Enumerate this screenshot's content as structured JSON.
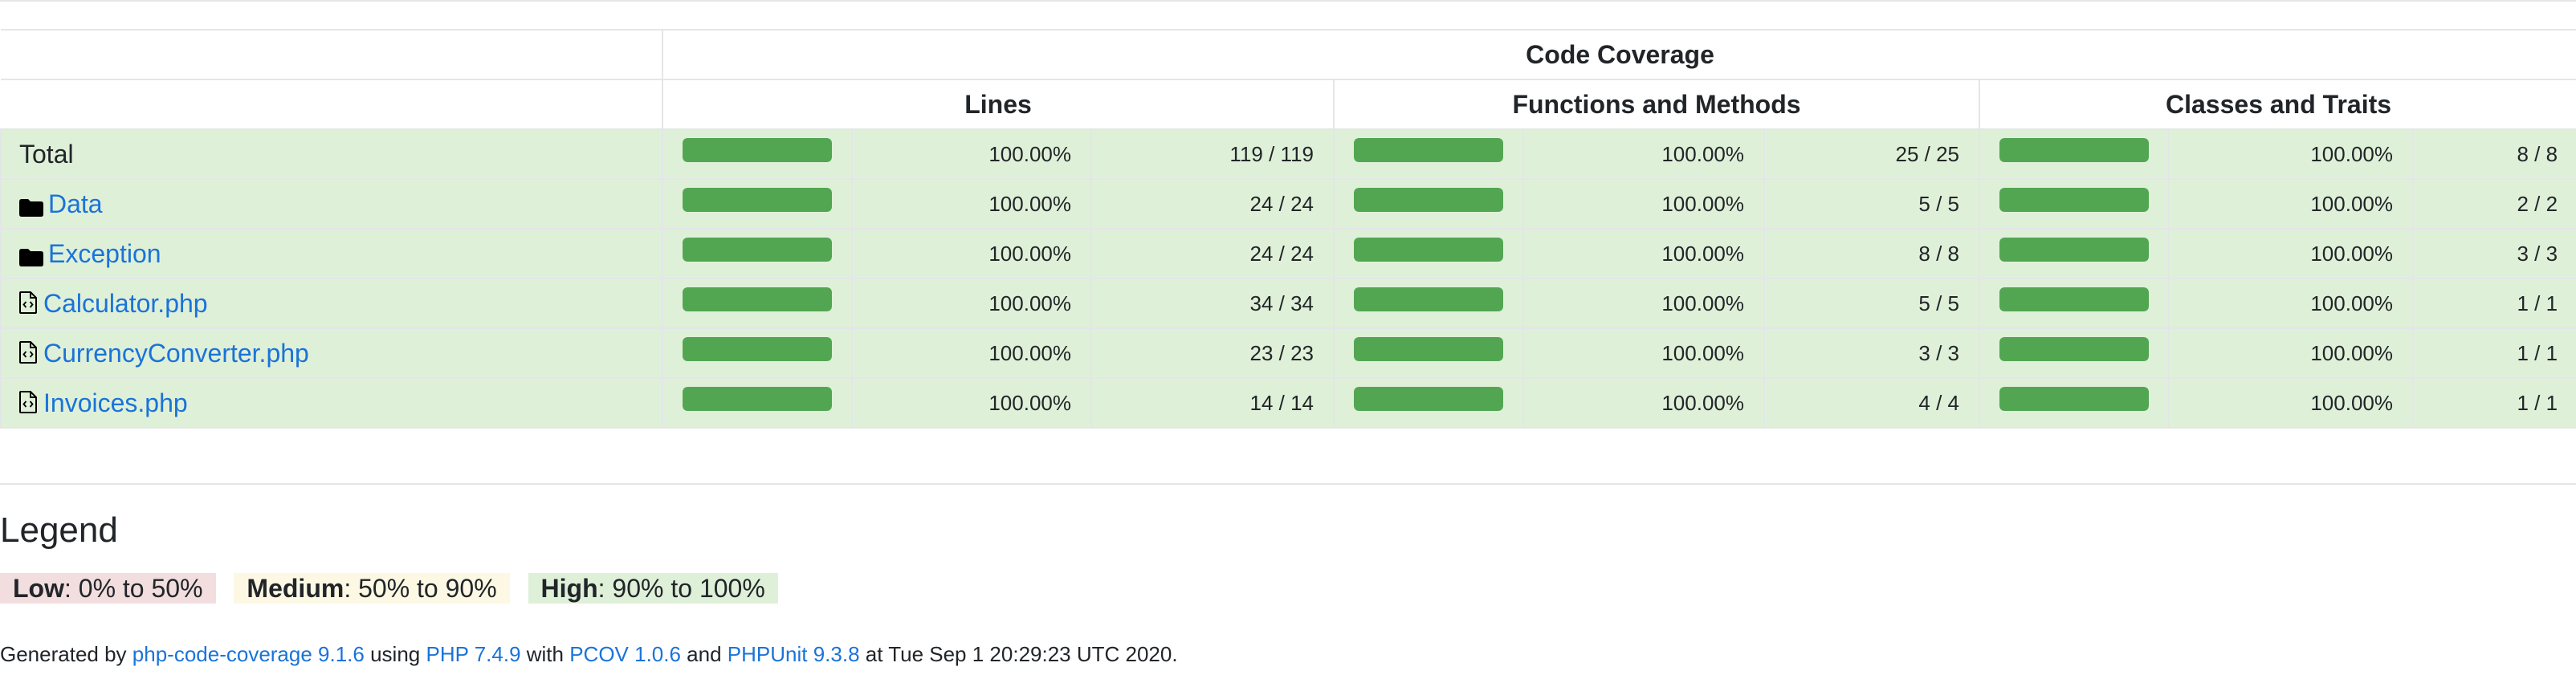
{
  "table": {
    "header": "Code Coverage",
    "groups": [
      "Lines",
      "Functions and Methods",
      "Classes and Traits"
    ],
    "rows": [
      {
        "name": "Total",
        "type": "total",
        "lines": {
          "pct": "100.00%",
          "count": "119 / 119",
          "fill": 1.0
        },
        "functions": {
          "pct": "100.00%",
          "count": "25 / 25",
          "fill": 1.0
        },
        "classes": {
          "pct": "100.00%",
          "count": "8 / 8",
          "fill": 1.0
        }
      },
      {
        "name": "Data",
        "type": "folder",
        "lines": {
          "pct": "100.00%",
          "count": "24 / 24",
          "fill": 1.0
        },
        "functions": {
          "pct": "100.00%",
          "count": "5 / 5",
          "fill": 1.0
        },
        "classes": {
          "pct": "100.00%",
          "count": "2 / 2",
          "fill": 1.0
        }
      },
      {
        "name": "Exception",
        "type": "folder",
        "lines": {
          "pct": "100.00%",
          "count": "24 / 24",
          "fill": 1.0
        },
        "functions": {
          "pct": "100.00%",
          "count": "8 / 8",
          "fill": 1.0
        },
        "classes": {
          "pct": "100.00%",
          "count": "3 / 3",
          "fill": 1.0
        }
      },
      {
        "name": "Calculator.php",
        "type": "file",
        "lines": {
          "pct": "100.00%",
          "count": "34 / 34",
          "fill": 1.0
        },
        "functions": {
          "pct": "100.00%",
          "count": "5 / 5",
          "fill": 1.0
        },
        "classes": {
          "pct": "100.00%",
          "count": "1 / 1",
          "fill": 1.0
        }
      },
      {
        "name": "CurrencyConverter.php",
        "type": "file",
        "lines": {
          "pct": "100.00%",
          "count": "23 / 23",
          "fill": 1.0
        },
        "functions": {
          "pct": "100.00%",
          "count": "3 / 3",
          "fill": 1.0
        },
        "classes": {
          "pct": "100.00%",
          "count": "1 / 1",
          "fill": 1.0
        }
      },
      {
        "name": "Invoices.php",
        "type": "file",
        "lines": {
          "pct": "100.00%",
          "count": "14 / 14",
          "fill": 1.0
        },
        "functions": {
          "pct": "100.00%",
          "count": "4 / 4",
          "fill": 1.0
        },
        "classes": {
          "pct": "100.00%",
          "count": "1 / 1",
          "fill": 1.0
        }
      }
    ]
  },
  "legend": {
    "title": "Legend",
    "low": {
      "label": "Low",
      "range": ": 0% to 50%"
    },
    "medium": {
      "label": "Medium",
      "range": ": 50% to 90%"
    },
    "high": {
      "label": "High",
      "range": ": 90% to 100%"
    }
  },
  "footer": {
    "prefix": "Generated by ",
    "tool": "php-code-coverage 9.1.6",
    "using": " using ",
    "php": "PHP 7.4.9",
    "with": " with ",
    "pcov": "PCOV 1.0.6",
    "and": " and ",
    "phpunit": "PHPUnit 9.3.8",
    "at": " at Tue Sep 1 20:29:23 UTC 2020."
  },
  "colors": {
    "high_bg": "#dff0d8",
    "bar_fill": "#52a652",
    "link": "#1a73d9",
    "low_bg": "#f2dede",
    "medium_bg": "#fcf8e3"
  }
}
